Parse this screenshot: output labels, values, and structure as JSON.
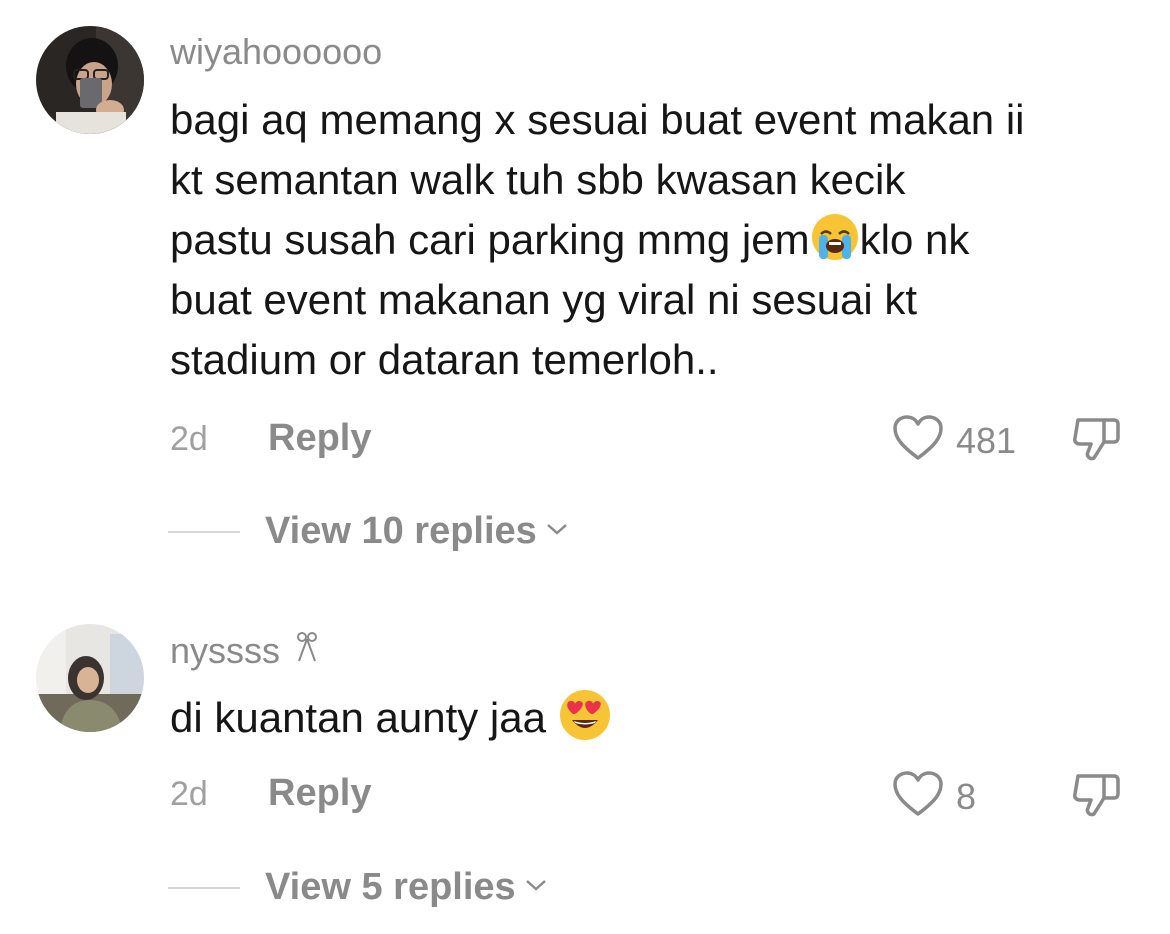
{
  "comments": [
    {
      "username": "wiyahoooooo",
      "avatar_icon": "person-selfie-avatar",
      "lines": [
        {
          "text": "bagi aq memang x sesuai buat event makan ii"
        },
        {
          "text": "kt semantan walk tuh sbb kwasan kecik"
        },
        {
          "before": "pastu susah cari parking mmg jem",
          "emoji": "loudly-crying-face-emoji",
          "after": "klo nk"
        },
        {
          "text": "buat event makanan yg viral ni sesuai kt"
        },
        {
          "text": "stadium or dataran temerloh.."
        }
      ],
      "time": "2d",
      "reply_label": "Reply",
      "like_count": "481",
      "view_replies_label": "View 10 replies"
    },
    {
      "username": "nyssss",
      "username_suffix_icon": "ribbon-icon",
      "avatar_icon": "person-hijab-avatar",
      "text": "di kuantan aunty jaa ",
      "text_emoji": "heart-eyes-emoji",
      "time": "2d",
      "reply_label": "Reply",
      "like_count": "8",
      "view_replies_label": "View 5 replies"
    }
  ],
  "colors": {
    "text_primary": "#161616",
    "text_secondary": "#8a8a8a",
    "divider": "#d6d6d6",
    "emoji_yellow": "#f7c435",
    "heart_red": "#e8334a"
  }
}
